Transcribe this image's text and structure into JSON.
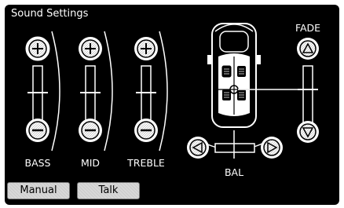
{
  "header": {
    "title": "Sound Settings"
  },
  "eq": {
    "bass_label": "BASS",
    "mid_label": "MID",
    "treble_label": "TREBLE"
  },
  "fade": {
    "label": "FADE"
  },
  "balance": {
    "label": "BAL"
  },
  "footer": {
    "manual_label": "Manual",
    "talk_label": "Talk"
  },
  "colors": {
    "background": "#000000",
    "foreground": "#ffffff",
    "button": "#d8d8d8"
  }
}
